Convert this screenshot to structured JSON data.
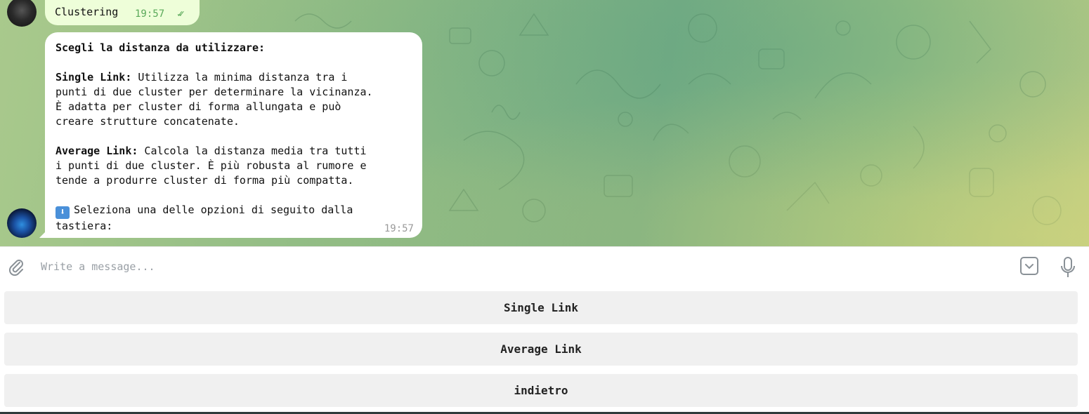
{
  "colors": {
    "outgoing_bubble": "#eefed9",
    "incoming_bubble": "#ffffff",
    "read_checks": "#5aa95a",
    "keyboard_button_bg": "#f0f0f0"
  },
  "messages": {
    "outgoing": {
      "text": "Clustering",
      "time": "19:57",
      "status_icon": "double-check-icon"
    },
    "incoming": {
      "heading": "Scegli la distanza da utilizzare:",
      "single_label": "Single Link:",
      "single_text_1": " Utilizza la minima distanza tra i",
      "single_text_2": "punti di due cluster per determinare la vicinanza.",
      "single_text_3": "È adatta per cluster di forma allungata e può",
      "single_text_4": "creare strutture concatenate.",
      "average_label": "Average Link:",
      "average_text_1": " Calcola la distanza media tra tutti",
      "average_text_2": "i punti di due cluster. È più robusta al rumore e",
      "average_text_3": "tende a produrre cluster di forma più compatta.",
      "prompt_emoji": "⬇",
      "prompt_text_1": "Seleziona una delle opzioni di seguito dalla",
      "prompt_text_2": "tastiera:",
      "time": "19:57"
    }
  },
  "composer": {
    "placeholder": "Write a message...",
    "attach_icon": "paperclip-icon",
    "keyboard_icon": "keyboard-toggle-icon",
    "mic_icon": "microphone-icon"
  },
  "reply_keyboard": {
    "buttons": [
      "Single Link",
      "Average Link",
      "indietro"
    ]
  }
}
